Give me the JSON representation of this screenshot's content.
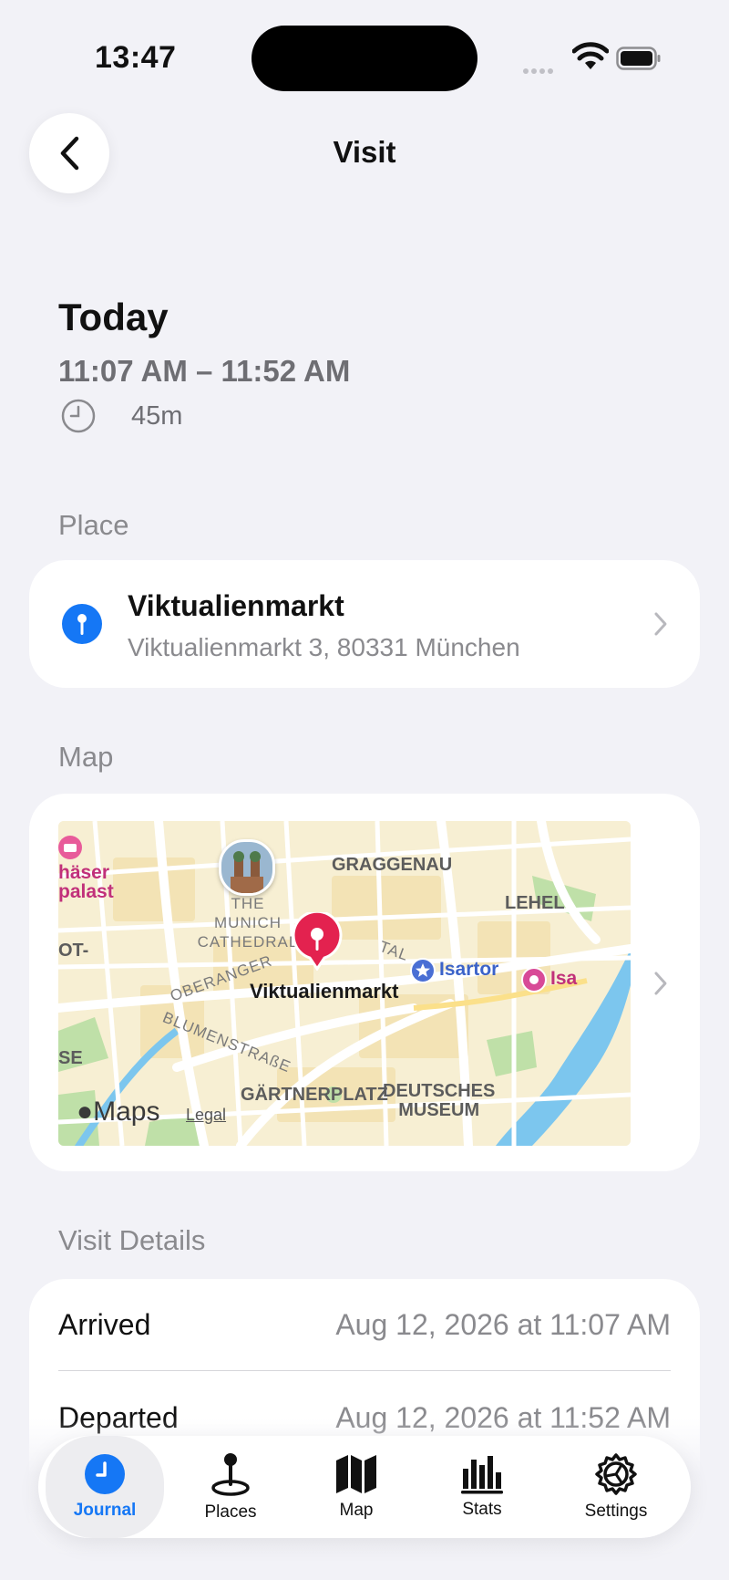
{
  "status_bar": {
    "time": "13:47"
  },
  "nav": {
    "title": "Visit"
  },
  "visit": {
    "day": "Today",
    "time_range": "11:07 AM – 11:52 AM",
    "duration": "45m"
  },
  "sections": {
    "place": "Place",
    "map": "Map",
    "details": "Visit Details"
  },
  "place": {
    "name": "Viktualienmarkt",
    "address": "Viktualienmarkt 3, 80331 München"
  },
  "map": {
    "pin_label": "Viktualienmarkt",
    "labels": {
      "graggenau": "GRAGGENAU",
      "cathedral": "THE MUNICH\nCATHEDRAL",
      "lehel": "LEHEL",
      "haeser": "häser\npalast",
      "ot": "OT-",
      "oberanger": "OBERANGER",
      "tal": "TAL",
      "isartor": "Isartor",
      "isa": "Isa",
      "blumenstrasse": "BLUMENSTRAßE",
      "gaertnerplatz": "GÄRTNERPLATZ",
      "deutsches_museum": "DEUTSCHES\nMUSEUM",
      "se": "SE"
    },
    "attribution": "Maps",
    "legal": "Legal"
  },
  "details": {
    "arrived_label": "Arrived",
    "arrived_value": "Aug 12, 2026 at 11:07 AM",
    "departed_label": "Departed",
    "departed_value": "Aug 12, 2026 at 11:52 AM"
  },
  "tabs": [
    {
      "label": "Journal",
      "icon": "clock-icon",
      "active": true
    },
    {
      "label": "Places",
      "icon": "pin-icon",
      "active": false
    },
    {
      "label": "Map",
      "icon": "map-icon",
      "active": false
    },
    {
      "label": "Stats",
      "icon": "chart-icon",
      "active": false
    },
    {
      "label": "Settings",
      "icon": "gear-icon",
      "active": false
    }
  ],
  "colors": {
    "accent": "#1577F5",
    "pin_red": "#E3224F",
    "background": "#F2F2F7"
  }
}
